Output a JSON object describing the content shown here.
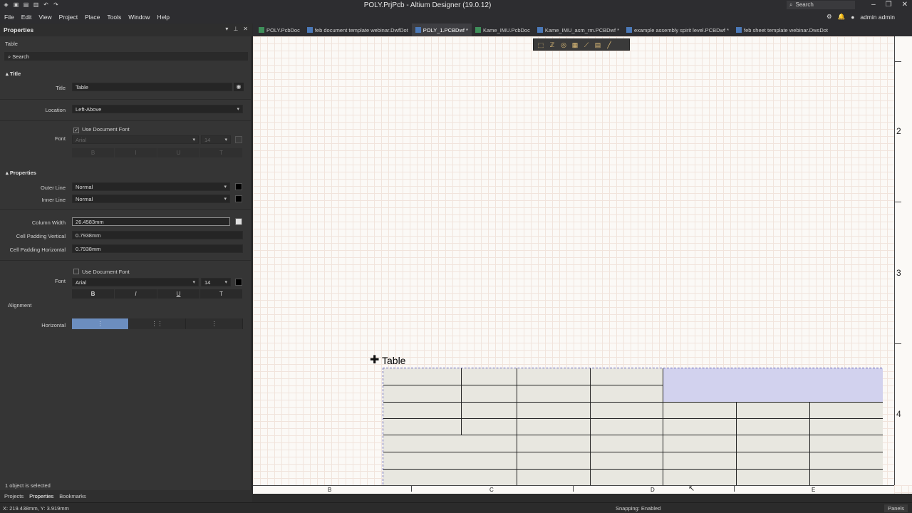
{
  "window": {
    "title": "POLY.PrjPcb - Altium Designer (19.0.12)",
    "search_placeholder": "Search",
    "user": "admin admin"
  },
  "menu": [
    "File",
    "Edit",
    "View",
    "Project",
    "Place",
    "Tools",
    "Window",
    "Help"
  ],
  "tabs": [
    {
      "label": "POLY.PcbDoc",
      "active": false
    },
    {
      "label": "feb document template webinar.DwfDot",
      "active": false
    },
    {
      "label": "POLY_1.PCBDwf *",
      "active": true
    },
    {
      "label": "Kame_IMU.PcbDoc",
      "active": false
    },
    {
      "label": "Kame_IMU_asm_rm.PCBDwf *",
      "active": false
    },
    {
      "label": "example assembly spirit level.PCBDwf *",
      "active": false
    },
    {
      "label": "feb sheet template webinar.DwsDot",
      "active": false
    }
  ],
  "panel": {
    "title": "Properties",
    "object_type": "Table",
    "search_placeholder": "Search",
    "title_section": {
      "header": "Title",
      "title_label": "Title",
      "title_value": "Table",
      "location_label": "Location",
      "location_value": "Left-Above",
      "use_doc_font_label": "Use Document Font",
      "font_label": "Font",
      "font_value": "Arial",
      "font_size": "14"
    },
    "properties_section": {
      "header": "Properties",
      "outer_line_label": "Outer Line",
      "outer_line_value": "Normal",
      "inner_line_label": "Inner Line",
      "inner_line_value": "Normal",
      "column_width_label": "Column Width",
      "column_width_value": "26.4583mm",
      "cell_padding_v_label": "Cell Padding Vertical",
      "cell_padding_v_value": "0.7938mm",
      "cell_padding_h_label": "Cell Padding Horizontal",
      "cell_padding_h_value": "0.7938mm",
      "use_doc_font_label": "Use Document Font",
      "font_label": "Font",
      "font_value": "Arial",
      "font_size": "14",
      "alignment_label": "Alignment",
      "horizontal_label": "Horizontal"
    },
    "format_buttons": [
      "B",
      "I",
      "U",
      "T"
    ],
    "selection_info": "1 object is selected",
    "footer_tabs": [
      "Projects",
      "Properties",
      "Bookmarks"
    ]
  },
  "canvas": {
    "table_caption": "Table",
    "ruler_right": [
      "2",
      "3",
      "4"
    ],
    "ruler_bottom": [
      "B",
      "C",
      "D",
      "E"
    ]
  },
  "status": {
    "coords": "X: 219.438mm, Y: 3.919mm",
    "snapping": "Snapping: Enabled",
    "panels": "Panels"
  },
  "colors": {
    "selected_cell": "#d2d2ee",
    "table_cell": "#e8e7e0",
    "accent": "#6c8ebf"
  }
}
